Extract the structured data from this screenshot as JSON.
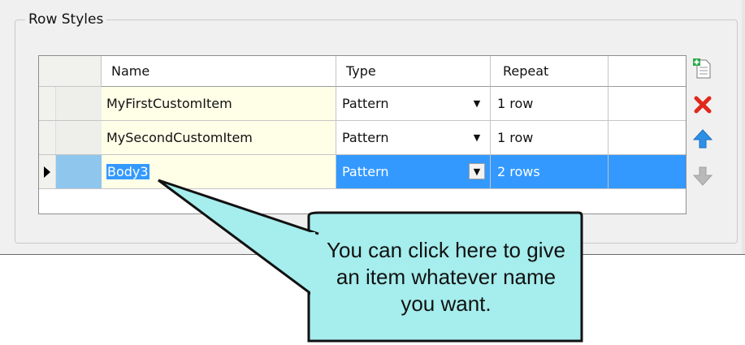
{
  "group": {
    "title": "Row Styles"
  },
  "columns": {
    "name": "Name",
    "type": "Type",
    "repeat": "Repeat"
  },
  "rows": [
    {
      "name": "MyFirstCustomItem",
      "type": "Pattern",
      "repeat": "1 row",
      "selected": false
    },
    {
      "name": "MySecondCustomItem",
      "type": "Pattern",
      "repeat": "1 row",
      "selected": false
    },
    {
      "name": "Body3",
      "type": "Pattern",
      "repeat": "2 rows",
      "selected": true
    }
  ],
  "toolbar": [
    {
      "icon": "add-row-icon"
    },
    {
      "icon": "delete-icon"
    },
    {
      "icon": "move-up-icon"
    },
    {
      "icon": "move-down-icon"
    }
  ],
  "callout": {
    "text": "You can click here to give an item whatever name you want."
  },
  "colors": {
    "selection": "#3399ff",
    "name_cell": "#ffffe8",
    "callout_fill": "#a6eded",
    "delete_red": "#e0281c",
    "up_blue": "#2e8fe6"
  }
}
